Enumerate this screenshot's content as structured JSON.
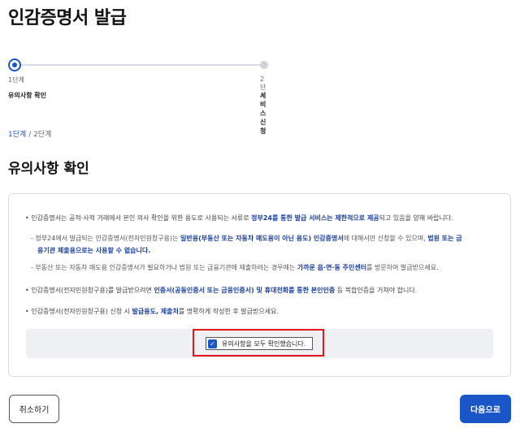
{
  "page": {
    "title": "인감증명서 발급"
  },
  "stepper": {
    "steps": [
      {
        "number": "1단계",
        "name": "유의사항 확인",
        "state": "current"
      },
      {
        "number": "2단계",
        "name": "서비스 신청",
        "state": "upcoming"
      }
    ]
  },
  "breadcrumb": {
    "current": "1단계",
    "separator": " / ",
    "total": "2단계"
  },
  "section": {
    "title": "유의사항 확인"
  },
  "notices": {
    "n1": {
      "a": "• 인감증명서는 공적·사적 거래에서 본인 의사 확인을 위한 용도로 사용되는 서류로 ",
      "b": "정부24를 통한 발급 서비스는 제한적으로 제공",
      "c": "되고 있음을 양해 바랍니다."
    },
    "n2": {
      "a": "- 정부24에서 발급되는 인감증명서(전자민원창구용)는 ",
      "b": "일반용(부동산 또는 자동차 매도용이 아닌 용도) 인감증명서",
      "c": "에 대해서만 신청할 수 있으며, ",
      "d": "법원 또는 금",
      "e": "융기관 제출용으로는 사용할 수 없습니다."
    },
    "n3": {
      "a": "- 부동산 또는 자동차 매도용 인감증명서가 필요하거나 법원 또는 금융기관에 제출하려는 경우에는 ",
      "b": "가까운 읍·면·동 주민센터",
      "c": "를 방문하여 발급받으세요."
    },
    "n4": {
      "a": "• 인감증명서(전자민원창구용)를 발급받으려면 ",
      "b": "인증서(공동인증서 또는 금융인증서) 및 휴대전화를 통한 본인인증",
      "c": " 등 복합인증을 거쳐야 합니다."
    },
    "n5": {
      "a": "• 인감증명서(전자민원창구용) 신청 시 ",
      "b": "발급용도, 제출처",
      "c": "를 명확하게 작성한 후 발급받으세요."
    }
  },
  "confirm": {
    "label": "유의사항을 모두 확인했습니다.",
    "checked": true
  },
  "buttons": {
    "cancel": "취소하기",
    "next": "다음으로"
  },
  "colors": {
    "accent": "#1a56c8",
    "highlight_text": "#1a3fa0",
    "annotation_frame": "#e0161b"
  }
}
